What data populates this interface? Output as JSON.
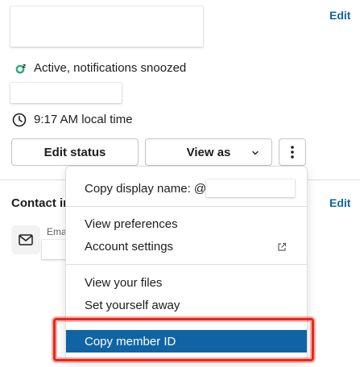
{
  "header": {
    "edit_label": "Edit"
  },
  "status": {
    "text": "Active, notifications snoozed"
  },
  "local_time": {
    "text": "9:17 AM local time"
  },
  "actions": {
    "edit_status": "Edit status",
    "view_as": "View as"
  },
  "contact": {
    "heading": "Contact in",
    "edit_label": "Edit",
    "email_label": "Ema"
  },
  "menu": {
    "copy_display_name": "Copy display name: @",
    "view_preferences": "View preferences",
    "account_settings": "Account settings",
    "view_files": "View your files",
    "set_away": "Set yourself away",
    "copy_member_id": "Copy member ID"
  },
  "colors": {
    "link": "#1264a3",
    "selected": "#1164a3",
    "highlight": "#e8291c",
    "presence": "#2bac76"
  }
}
